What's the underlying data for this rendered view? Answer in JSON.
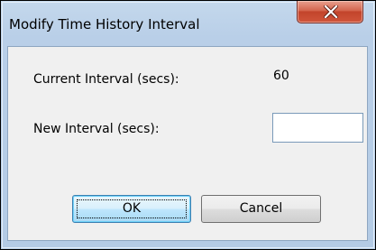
{
  "window": {
    "title": "Modify Time History Interval",
    "close_icon": "close-icon"
  },
  "form": {
    "current_interval": {
      "label": "Current Interval (secs):",
      "value": "60"
    },
    "new_interval": {
      "label": "New Interval (secs):",
      "value": ""
    }
  },
  "buttons": {
    "ok_label": "OK",
    "cancel_label": "Cancel"
  },
  "colors": {
    "title_bar": "#b9cfe8",
    "close_button": "#c9503a",
    "client_area": "#f0f0f0",
    "default_button": "#bee6fd"
  }
}
